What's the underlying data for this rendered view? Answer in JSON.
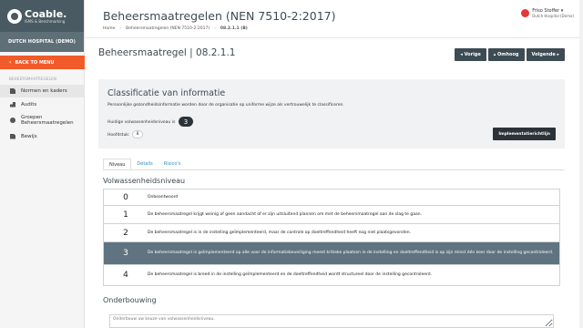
{
  "app": {
    "logo_name": "Coable.",
    "logo_sub": "ISMS & Benchmarking",
    "org": "DUTCH HOSPITAL (DEMO)"
  },
  "sidebar": {
    "back_label": "BACK TO MENU",
    "section_label": "BEHEERSMAATREGELEN",
    "items": [
      {
        "label": "Normen en kaders",
        "icon": "document-icon"
      },
      {
        "label": "Audits",
        "icon": "audit-icon"
      },
      {
        "label": "Groepen Beheersmaatregelen",
        "icon": "group-icon"
      },
      {
        "label": "Bewijs",
        "icon": "file-icon"
      }
    ]
  },
  "header": {
    "title": "Beheersmaatregelen (NEN 7510-2:2017)",
    "breadcrumb": [
      "Home",
      "Beheersmaatregelen (NEN 7510-2:2017)",
      "08.2.1.1 (B)"
    ],
    "user_name": "Friso Stoffer ▾",
    "user_org": "Dutch Hospital (Demo)",
    "avatar_color": "#e53935"
  },
  "measure": {
    "title": "Beheersmaatregel | 08.2.1.1",
    "buttons": {
      "prev": "◂ Vorige",
      "up": "▴ Omhoog",
      "next": "Volgende ▸"
    }
  },
  "classification": {
    "title": "Classificatie van informatie",
    "description": "Persoonlijke gezondheidsinformatie worden door de organisatie op uniforme wijze als vertrouwelijk te classificeren.",
    "level_label": "Huidige volwassenheidsniveau is",
    "level_value": "3",
    "chapter_label": "Hoofdstuk:",
    "chapter_value": "8",
    "impl_button": "Implementatierichtlijn"
  },
  "tabs": [
    {
      "label": "Niveau",
      "active": true
    },
    {
      "label": "Details",
      "active": false
    },
    {
      "label": "Risico's",
      "active": false
    }
  ],
  "maturity": {
    "title": "Volwassenheidsniveau",
    "selected_level": 3,
    "levels": [
      {
        "num": "0",
        "text": "Onbeantwoord"
      },
      {
        "num": "1",
        "text": "De beheersmaatregel krijgt weinig of geen aandacht of er zijn uitsluitend plannen om met de beheersmaatregel aan de slag te gaan."
      },
      {
        "num": "2",
        "text": "De beheersmaatregel is in de instelling geïmplementeerd, maar de controle op doeltreffendheid heeft nog niet plaatsgevonden."
      },
      {
        "num": "3",
        "text": "De beheersmaatregel is geïmplementeerd op alle voor de informatiebeveiliging meest kritieke plaatsen in de instelling en doeltreffendheid is op zijn minst één keer door de instelling gecontroleerd."
      },
      {
        "num": "4",
        "text": "De beheersmaatregel is breed in de instelling geïmplementeerd en de doeltreffendheid wordt structureel door de instelling gecontroleerd."
      }
    ]
  },
  "onderbouwing": {
    "title": "Onderbouwing",
    "placeholder": "Onderbouw uw keuze van volwassenheidsniveau."
  }
}
